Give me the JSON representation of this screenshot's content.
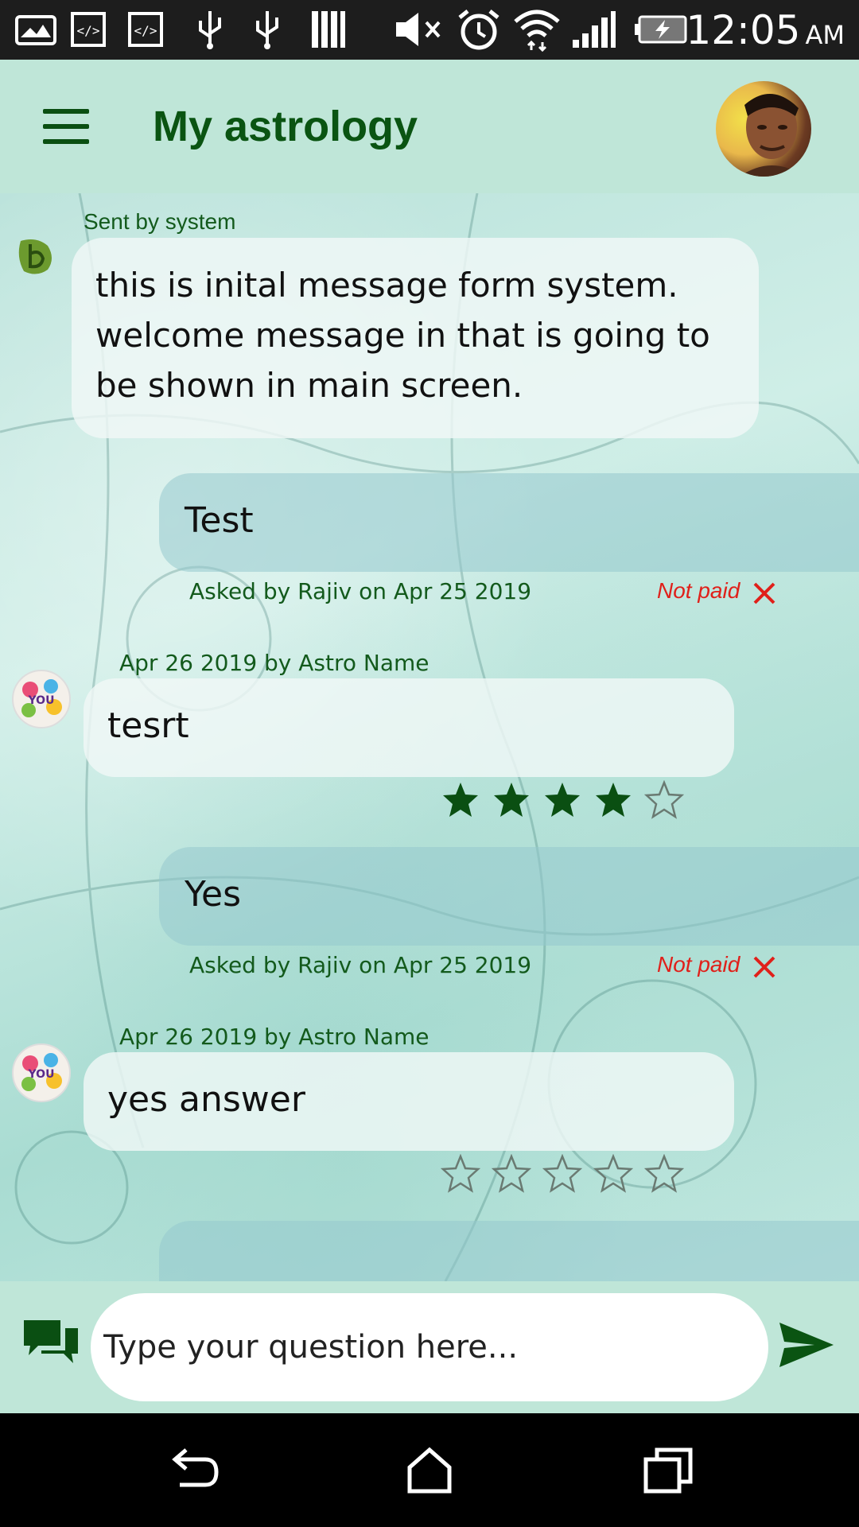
{
  "status_bar": {
    "time": "12:05",
    "ampm": "AM",
    "icons": [
      "picture-icon",
      "code-icon",
      "code-icon",
      "usb-icon",
      "usb-icon",
      "storage-icon",
      "mute-icon",
      "alarm-icon",
      "wifi-icon",
      "signal-icon",
      "battery-charging-icon"
    ]
  },
  "app_bar": {
    "title": "My astrology",
    "menu_icon": "hamburger-menu-icon",
    "avatar_icon": "profile-avatar"
  },
  "chat": {
    "system_message": {
      "sender_label": "Sent by system",
      "text": "this is inital message form system. welcome message in that is going to be shown in main screen."
    },
    "threads": [
      {
        "question": "Test",
        "asked_meta": "Asked by Rajiv on Apr 25 2019",
        "payment_status": "Not paid",
        "answer_meta": "Apr 26 2019 by Astro Name",
        "answer": "tesrt",
        "rating": 4,
        "rating_max": 5
      },
      {
        "question": "Yes",
        "asked_meta": "Asked by Rajiv on Apr 25 2019",
        "payment_status": "Not paid",
        "answer_meta": "Apr 26 2019 by Astro Name",
        "answer": "yes answer",
        "rating": 0,
        "rating_max": 5
      }
    ]
  },
  "input_bar": {
    "placeholder": "Type your question here...",
    "value": ""
  },
  "colors": {
    "bar_bg": "#bfe6d8",
    "title_green": "#0a5412",
    "not_paid_red": "#e0201a",
    "star_green": "#0a4f12"
  }
}
